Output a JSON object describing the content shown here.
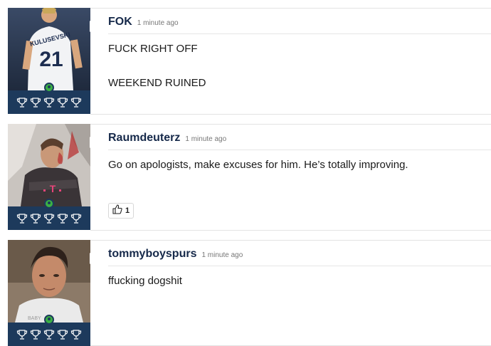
{
  "posts": [
    {
      "username": "FOK",
      "time": "1 minute ago",
      "body": [
        "FUCK RIGHT OFF",
        "WEEKEND RUINED"
      ],
      "trophies": 5,
      "likes": null
    },
    {
      "username": "Raumdeuterz",
      "time": "1 minute ago",
      "body": [
        "Go on apologists, make excuses for him. He’s totally improving."
      ],
      "trophies": 5,
      "likes": "1"
    },
    {
      "username": "tommyboyspurs",
      "time": "1 minute ago",
      "body": [
        "ffucking dogshit"
      ],
      "trophies": 5,
      "likes": null
    }
  ],
  "avatars": {
    "p1_jersey_text": "KULUSEVSKI",
    "p1_number": "21"
  },
  "colors": {
    "trophy_bar": "#1d3a5c",
    "online": "#3bb143",
    "username": "#16294a"
  }
}
